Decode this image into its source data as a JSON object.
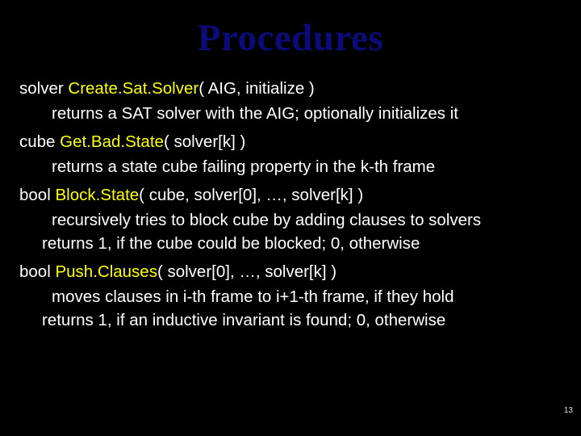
{
  "title": "Procedures",
  "items": [
    {
      "sig_pre": "solver ",
      "fn": "Create.Sat.Solver",
      "sig_post": "(  AIG, initialize  )",
      "desc": [
        "returns a SAT solver with the AIG; optionally initializes it"
      ]
    },
    {
      "sig_pre": "cube ",
      "fn": "Get.Bad.State",
      "sig_post": "( solver[k] )",
      "desc": [
        "returns a state cube failing property in the k-th frame"
      ]
    },
    {
      "sig_pre": "bool ",
      "fn": "Block.State",
      "sig_post": "( cube, solver[0], …, solver[k] )",
      "desc": [
        "recursively tries to block cube by adding clauses to solvers",
        "returns 1, if the cube could be blocked; 0, otherwise"
      ]
    },
    {
      "sig_pre": "bool ",
      "fn": "Push.Clauses",
      "sig_post": "( solver[0], …, solver[k] )",
      "desc": [
        "moves clauses in i-th frame to i+1-th frame, if they hold",
        "returns 1, if an inductive invariant is found; 0, otherwise"
      ]
    }
  ],
  "page_number": "13"
}
